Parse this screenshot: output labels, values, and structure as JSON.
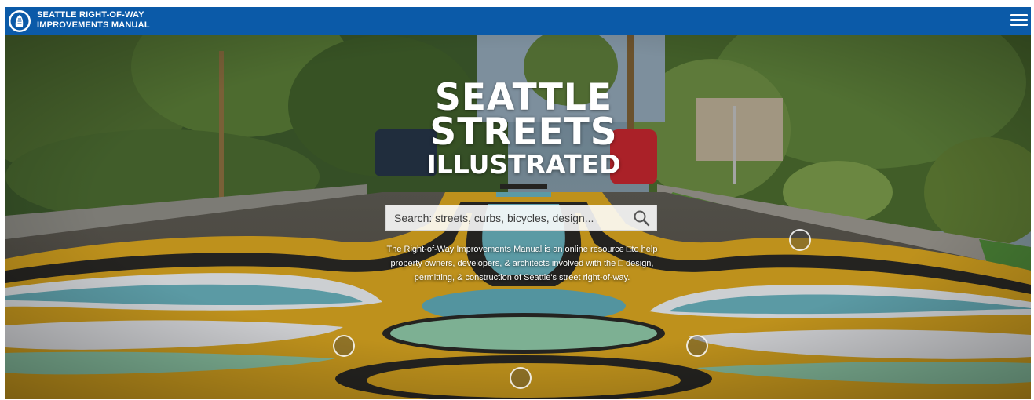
{
  "header": {
    "brand_line1": "SEATTLE RIGHT-OF-WAY",
    "brand_line2": "IMPROVEMENTS MANUAL",
    "logo_icon": "seattle-seal-icon",
    "menu_icon": "hamburger-menu-icon"
  },
  "hero": {
    "title_line1": "SEATTLE",
    "title_line2": "STREETS",
    "title_line3": "ILLUSTRATED",
    "search_placeholder": "Search: streets, curbs, bicycles, design...",
    "search_icon": "search-icon",
    "description": "The Right-of-Way Improvements Manual is an online resource □to help property owners, developers, & architects involved with the □ design, permitting, & construction of Seattle's street right-of-way.",
    "hotspot_count": 4
  },
  "colors": {
    "header_bg": "#0b5aa8",
    "mural_yellow": "#d9a520",
    "mural_teal": "#5fa9b5",
    "mural_green": "#8fc9a8"
  }
}
